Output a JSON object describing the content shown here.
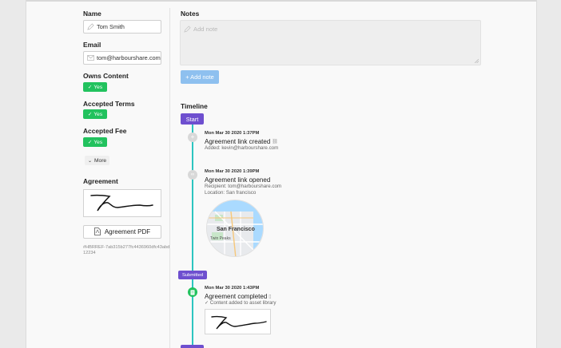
{
  "form": {
    "name_label": "Name",
    "name_value": "Tom Smith",
    "email_label": "Email",
    "email_value": "tom@harbourshare.com",
    "owns_content_label": "Owns Content",
    "owns_content_value": "Yes",
    "accepted_terms_label": "Accepted Terms",
    "accepted_terms_value": "Yes",
    "accepted_fee_label": "Accepted Fee",
    "accepted_fee_value": "Yes",
    "more_label": "More",
    "agreement_label": "Agreement",
    "agreement_pdf_label": "Agreement PDF",
    "reference": "#HBRREF-7ab315b277fc4436960dfc43abd12234"
  },
  "notes": {
    "label": "Notes",
    "placeholder": "Add note",
    "add_button": "+ Add note"
  },
  "timeline": {
    "label": "Timeline",
    "start_badge": "Start",
    "events": [
      {
        "date": "Mon Mar 30 2020 1:37PM",
        "title": "Agreement link created",
        "lines": [
          "Added: kevin@harbourshare.com"
        ]
      },
      {
        "date": "Mon Mar 30 2020 1:39PM",
        "title": "Agreement link opened",
        "lines": [
          "Recipient: tom@harbourshare.com",
          "Location: San francisco"
        ],
        "map_label": "San Francisco",
        "map_sublabel": "Twin Peaks"
      },
      {
        "date": "Mon Mar 30 2020 1:43PM",
        "title": "Agreement completed",
        "lines": [
          "✓ Content added to asset library"
        ]
      }
    ],
    "submitted_badge": "Submitted"
  },
  "colors": {
    "yes_green": "#22c25e",
    "timeline_teal": "#2cc5c0",
    "badge_purple": "#6e4fcf",
    "add_button_blue": "#8ec0ef"
  }
}
